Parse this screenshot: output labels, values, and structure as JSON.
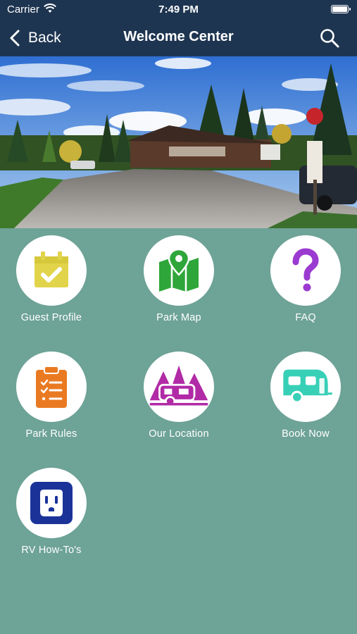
{
  "status": {
    "carrier": "Carrier",
    "time": "7:49 PM"
  },
  "nav": {
    "back_label": "Back",
    "title": "Welcome Center"
  },
  "tiles": [
    {
      "label": "Guest Profile",
      "icon": "calendar-check-icon",
      "color": "#e2d44a"
    },
    {
      "label": "Park Map",
      "icon": "map-pin-icon",
      "color": "#2fa63a"
    },
    {
      "label": "FAQ",
      "icon": "question-mark-icon",
      "color": "#9b3ad1"
    },
    {
      "label": "Park Rules",
      "icon": "clipboard-list-icon",
      "color": "#ea7a22"
    },
    {
      "label": "Our Location",
      "icon": "camper-trees-icon",
      "color": "#b12aa6"
    },
    {
      "label": "Book Now",
      "icon": "travel-trailer-icon",
      "color": "#37d0b7"
    },
    {
      "label": "RV How-To's",
      "icon": "power-outlet-icon",
      "color": "#1b3399"
    }
  ]
}
